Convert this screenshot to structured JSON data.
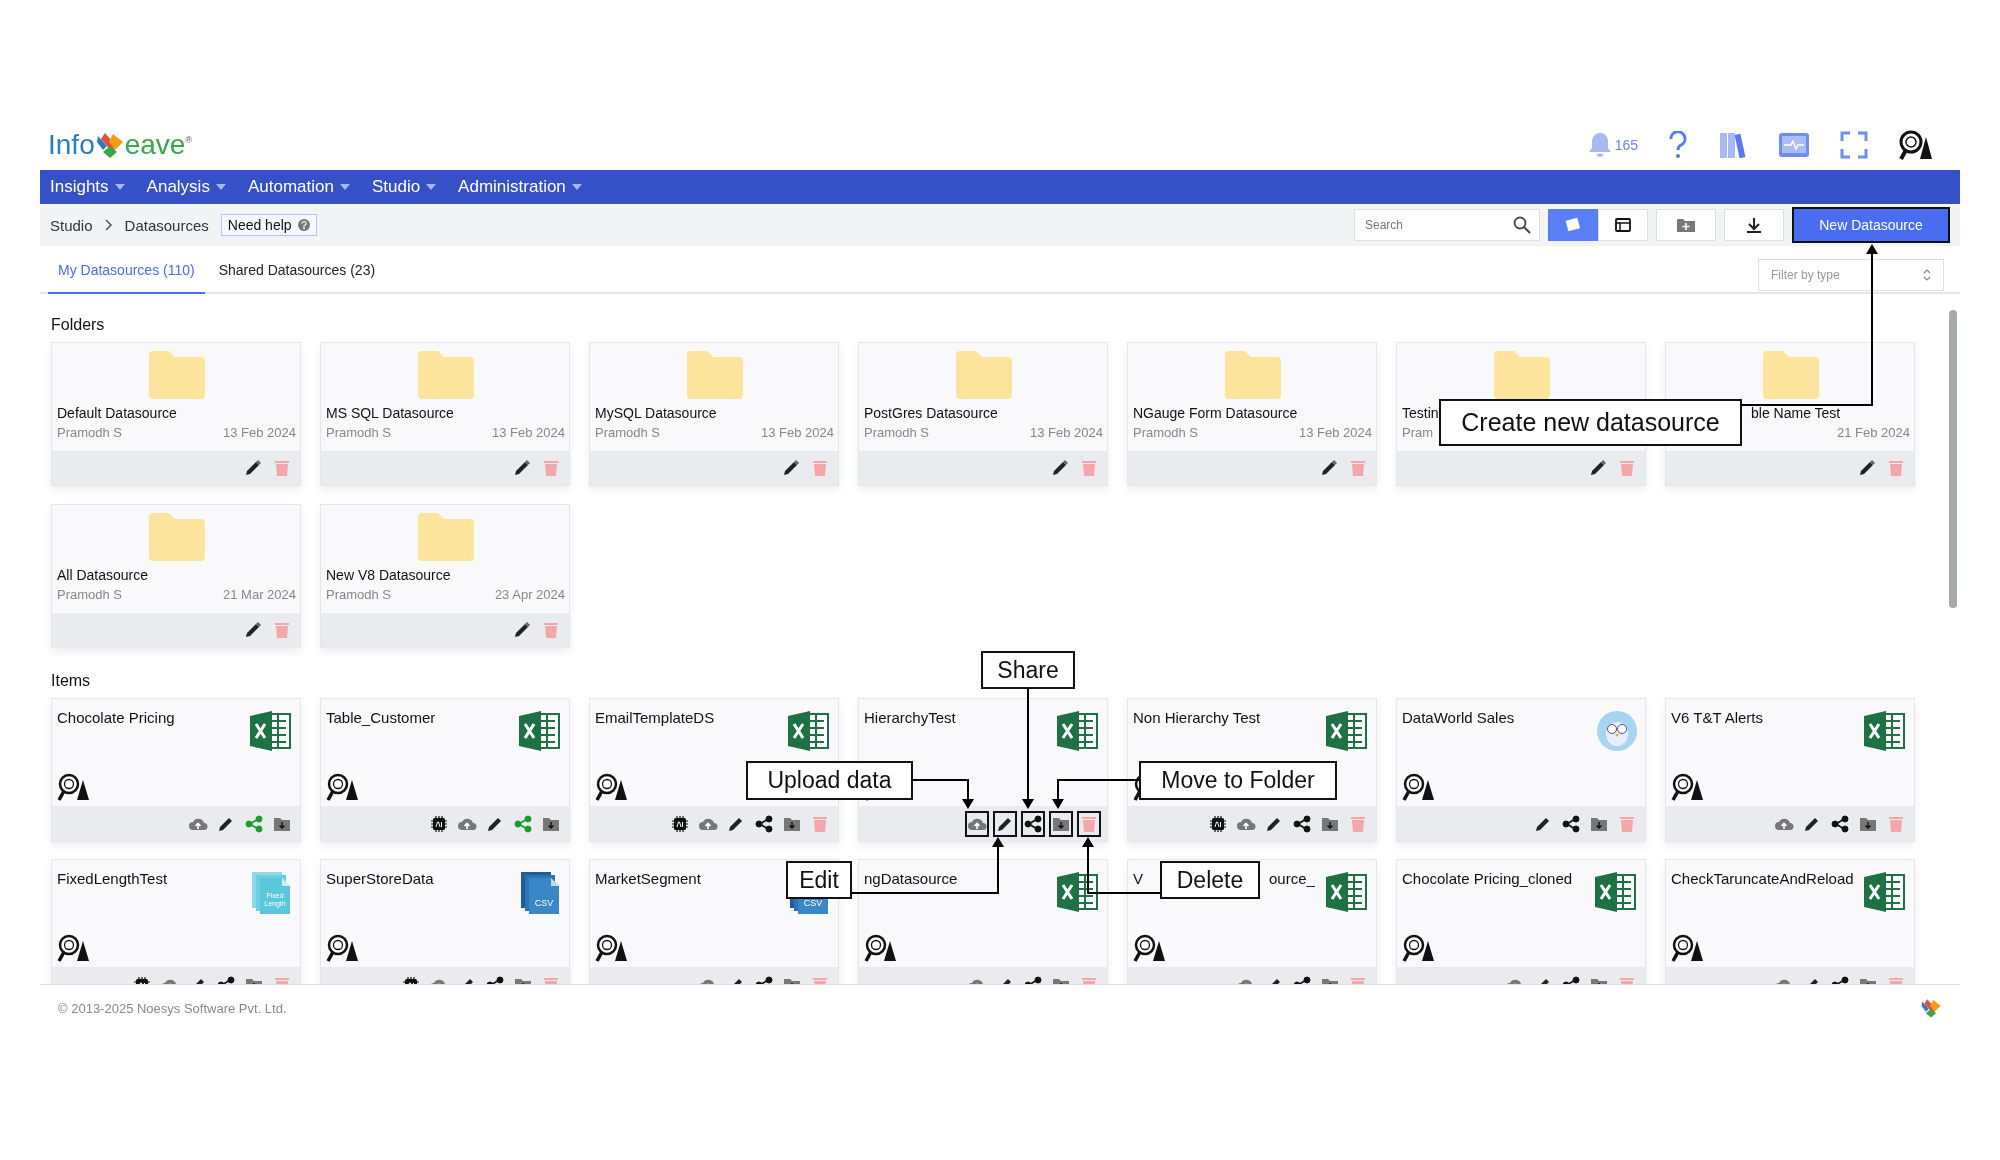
{
  "logo": {
    "left": "Info",
    "right": "eave",
    "mark": "®"
  },
  "header": {
    "notification_count": "165"
  },
  "nav": [
    "Insights",
    "Analysis",
    "Automation",
    "Studio",
    "Administration"
  ],
  "breadcrumb": [
    "Studio",
    "Datasources"
  ],
  "help_button": "Need help",
  "search": {
    "placeholder": "Search"
  },
  "view_toggle": [
    {
      "kind": "cards",
      "selected": true
    },
    {
      "kind": "table",
      "selected": false
    }
  ],
  "new_button": "New Datasource",
  "tabs": [
    {
      "label": "My Datasources (110)",
      "selected": true
    },
    {
      "label": "Shared Datasources (23)",
      "selected": false
    }
  ],
  "filter": {
    "placeholder": "Filter by type"
  },
  "folders_heading": "Folders",
  "folders": [
    {
      "name": "Default Datasource",
      "author": "Pramodh S",
      "date": "13 Feb 2024"
    },
    {
      "name": "MS SQL Datasource",
      "author": "Pramodh S",
      "date": "13 Feb 2024"
    },
    {
      "name": "MySQL Datasource",
      "author": "Pramodh S",
      "date": "13 Feb 2024"
    },
    {
      "name": "PostGres Datasource",
      "author": "Pramodh S",
      "date": "13 Feb 2024"
    },
    {
      "name": "NGauge Form Datasource",
      "author": "Pramodh S",
      "date": "13 Feb 2024"
    },
    {
      "name": "Testin",
      "author": "Pram"
    },
    {
      "name": "ble Name Test",
      "date": "21 Feb 2024",
      "covered": true
    },
    {
      "name": "All Datasource",
      "author": "Pramodh S",
      "date": "21 Mar 2024"
    },
    {
      "name": "New V8 Datasource",
      "author": "Pramodh S",
      "date": "23 Apr 2024"
    }
  ],
  "items_heading": "Items",
  "items": [
    {
      "name": "Chocolate Pricing",
      "kind": "excel",
      "shared": true,
      "highlighted": false,
      "actions": [
        {
          "kind": "upload"
        },
        {
          "kind": "edit"
        },
        {
          "kind": "share"
        },
        {
          "kind": "move"
        }
      ]
    },
    {
      "name": "Table_Customer",
      "kind": "excel",
      "shared": true,
      "highlighted": false,
      "actions": [
        {
          "kind": "ai"
        },
        {
          "kind": "upload"
        },
        {
          "kind": "edit"
        },
        {
          "kind": "share"
        },
        {
          "kind": "move"
        }
      ]
    },
    {
      "name": "EmailTemplateDS",
      "kind": "excel",
      "shared": false,
      "highlighted": false,
      "actions": [
        {
          "kind": "ai"
        },
        {
          "kind": "upload"
        },
        {
          "kind": "edit"
        },
        {
          "kind": "share"
        },
        {
          "kind": "move"
        },
        {
          "kind": "delete"
        }
      ]
    },
    {
      "name": "HierarchyTest",
      "kind": "excel",
      "shared": false,
      "highlighted": true,
      "actions": [
        {
          "kind": "upload"
        },
        {
          "kind": "edit"
        },
        {
          "kind": "share"
        },
        {
          "kind": "move"
        },
        {
          "kind": "delete"
        }
      ]
    },
    {
      "name": "Non Hierarchy Test",
      "kind": "excel",
      "shared": false,
      "highlighted": false,
      "actions": [
        {
          "kind": "ai"
        },
        {
          "kind": "upload"
        },
        {
          "kind": "edit"
        },
        {
          "kind": "share"
        },
        {
          "kind": "move"
        },
        {
          "kind": "delete"
        }
      ]
    },
    {
      "name": "DataWorld Sales",
      "kind": "owl",
      "shared": false,
      "highlighted": false,
      "actions": [
        {
          "kind": "edit"
        },
        {
          "kind": "share"
        },
        {
          "kind": "move"
        },
        {
          "kind": "delete"
        }
      ]
    },
    {
      "name": "V6 T&T Alerts",
      "kind": "excel",
      "shared": false,
      "highlighted": false,
      "actions": [
        {
          "kind": "upload"
        },
        {
          "kind": "edit"
        },
        {
          "kind": "share"
        },
        {
          "kind": "move"
        },
        {
          "kind": "delete"
        }
      ]
    },
    {
      "name": "FixedLengthTest",
      "kind": "fixed",
      "file_label": "Fixed Length",
      "actions": [
        {
          "kind": "ai"
        },
        {
          "kind": "upload"
        },
        {
          "kind": "edit"
        },
        {
          "kind": "share"
        },
        {
          "kind": "move"
        },
        {
          "kind": "delete"
        }
      ]
    },
    {
      "name": "SuperStoreData",
      "kind": "csv",
      "file_label": "CSV",
      "actions": [
        {
          "kind": "ai"
        },
        {
          "kind": "upload"
        },
        {
          "kind": "edit"
        },
        {
          "kind": "share"
        },
        {
          "kind": "move"
        },
        {
          "kind": "delete"
        }
      ]
    },
    {
      "name": "MarketSegment",
      "kind": "csv",
      "file_label": "CSV",
      "actions": [
        {
          "kind": "upload"
        },
        {
          "kind": "edit"
        },
        {
          "kind": "share"
        },
        {
          "kind": "move"
        },
        {
          "kind": "delete"
        }
      ]
    },
    {
      "name": "ngDatasource",
      "kind": "excel",
      "actions": [
        {
          "kind": "upload"
        },
        {
          "kind": "edit"
        },
        {
          "kind": "share"
        },
        {
          "kind": "move"
        },
        {
          "kind": "delete"
        }
      ]
    },
    {
      "name_parts": [
        "V",
        "ource_"
      ],
      "kind": "excel",
      "actions": [
        {
          "kind": "upload"
        },
        {
          "kind": "edit"
        },
        {
          "kind": "share"
        },
        {
          "kind": "move"
        },
        {
          "kind": "delete"
        }
      ]
    },
    {
      "name": "Chocolate Pricing_cloned",
      "kind": "excel",
      "actions": [
        {
          "kind": "upload"
        },
        {
          "kind": "edit"
        },
        {
          "kind": "share"
        },
        {
          "kind": "move"
        },
        {
          "kind": "delete"
        }
      ]
    },
    {
      "name": "CheckTaruncateAndReload",
      "kind": "excel",
      "actions": [
        {
          "kind": "upload"
        },
        {
          "kind": "edit"
        },
        {
          "kind": "share"
        },
        {
          "kind": "move"
        },
        {
          "kind": "delete"
        }
      ]
    }
  ],
  "footer": "© 2013-2025 Noesys Software Pvt. Ltd.",
  "callouts": [
    {
      "text": "Create new datasource"
    },
    {
      "text": "Share"
    },
    {
      "text": "Upload data"
    },
    {
      "text": "Move to Folder"
    },
    {
      "text": "Edit"
    },
    {
      "text": "Delete"
    }
  ]
}
